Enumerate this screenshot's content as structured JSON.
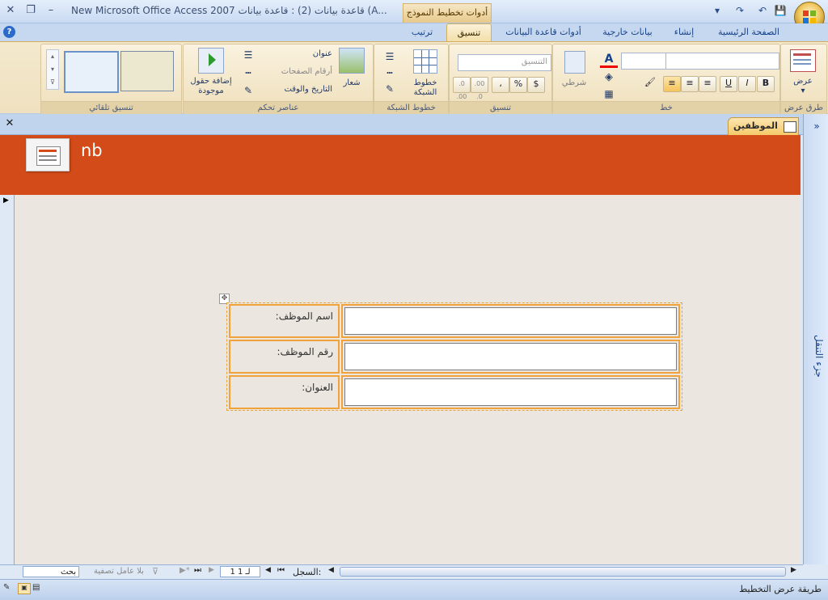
{
  "window": {
    "title": "New Microsoft Office Access 2007 قاعدة بيانات (2) : قاعدة بيانات (A...",
    "context_tab_group": "أدوات تخطيط النموذج",
    "min_label": "–",
    "restore_label": "❐",
    "close_label": "✕"
  },
  "qat": {
    "save": "💾",
    "undo": "↶",
    "redo": "↷",
    "customize": "▾"
  },
  "tabs": [
    {
      "label": "الصفحة الرئيسية"
    },
    {
      "label": "إنشاء"
    },
    {
      "label": "بيانات خارجية"
    },
    {
      "label": "أدوات قاعدة البيانات"
    },
    {
      "label": "تنسيق"
    },
    {
      "label": "ترتيب"
    }
  ],
  "ribbon": {
    "views": {
      "group_label": "طرق عرض",
      "view_button": "عرض"
    },
    "font": {
      "group_label": "خط",
      "bold": "B",
      "italic": "I",
      "underline": "U",
      "conditional": "شرطي"
    },
    "formatting": {
      "group_label": "تنسيق",
      "format_combo": "التنسيق",
      "currency": "$",
      "percent": "%",
      "comma": "،",
      "inc_dec": ".00 .0",
      "dec_dec": ".0 .00"
    },
    "gridlines": {
      "group_label": "خطوط الشبكة",
      "gridlines_button": "خطوط الشبكة"
    },
    "controls": {
      "group_label": "عناصر تحكم",
      "logo": "شعار",
      "title": "عنوان",
      "page_numbers": "أرقام الصفحات",
      "date_time": "التاريخ والوقت",
      "add_fields": "إضافة حقول موجودة"
    },
    "autoformat": {
      "group_label": "تنسيق تلقائي"
    }
  },
  "document": {
    "tab_label": "الموظفين",
    "header_title": "nb",
    "nav_pane_label": "جزء التنقل"
  },
  "form": {
    "fields": [
      {
        "label": "اسم الموظف:",
        "value": ""
      },
      {
        "label": "رقم الموظف:",
        "value": ""
      },
      {
        "label": "العنوان:",
        "value": ""
      }
    ]
  },
  "record_nav": {
    "record_label": "السجل:",
    "record_value": "1 لـ 1",
    "filter_label": "بلا عامل تصفية",
    "search_placeholder": "بحث"
  },
  "status_bar": {
    "view_name": "طريقة عرض التخطيط"
  },
  "colors": {
    "header_bg": "#d24b18",
    "layout_border": "#f2a23a",
    "ribbon_bg": "#f4e8cc",
    "body_bg": "#ebe6df"
  }
}
